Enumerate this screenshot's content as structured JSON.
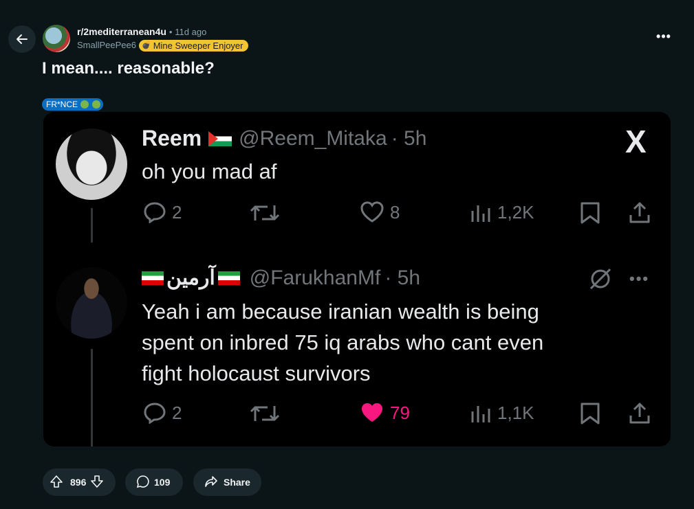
{
  "post": {
    "subreddit": "r/2mediterranean4u",
    "separator": "•",
    "age": "11d ago",
    "author": "SmallPeePee6",
    "author_flair": "Mine Sweeper Enjoyer",
    "title": "I mean.... reasonable?",
    "post_flair": "FR*NCE",
    "more": "•••"
  },
  "embed": {
    "tweet1": {
      "name": "Reem",
      "handle": "@Reem_Mitaka",
      "time": "· 5h",
      "text": "oh you mad af",
      "replies": "2",
      "likes": "8",
      "views": "1,2K"
    },
    "tweet2": {
      "name": "آرمین",
      "handle": "@FarukhanMf",
      "time": "· 5h",
      "text_lines": [
        "Yeah i am because iranian wealth is being",
        "spent on inbred 75 iq arabs who cant even",
        "fight holocaust survivors"
      ],
      "replies": "2",
      "likes": "79",
      "views": "1,1K",
      "more": "•••"
    },
    "logo": "X"
  },
  "actions": {
    "votes": "896",
    "comments": "109",
    "share": "Share"
  },
  "colors": {
    "background": "#0b1416",
    "pill": "#1a282d",
    "flair_yellow": "#f3c432",
    "post_flair_blue": "#0a6ec2",
    "like_pink": "#f91880"
  }
}
